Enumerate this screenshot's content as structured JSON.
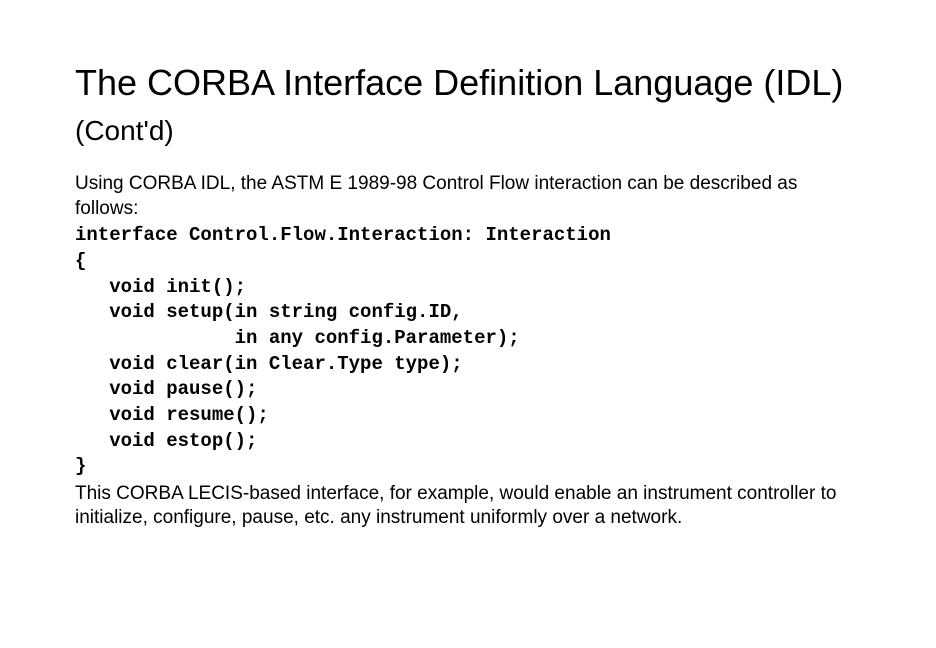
{
  "title": {
    "main": "The CORBA Interface Definition Language (IDL) ",
    "sub": " (Cont'd)"
  },
  "intro": "Using CORBA IDL, the ASTM E 1989-98 Control Flow interaction can be described as follows:",
  "code": "interface Control.Flow.Interaction: Interaction\n{\n   void init();\n   void setup(in string config.ID,\n              in any config.Parameter);\n   void clear(in Clear.Type type);\n   void pause();\n   void resume();\n   void estop();\n}",
  "outro": "This CORBA LECIS-based interface, for example,  would enable an instrument controller to initialize, configure, pause, etc. any instrument uniformly over a network."
}
